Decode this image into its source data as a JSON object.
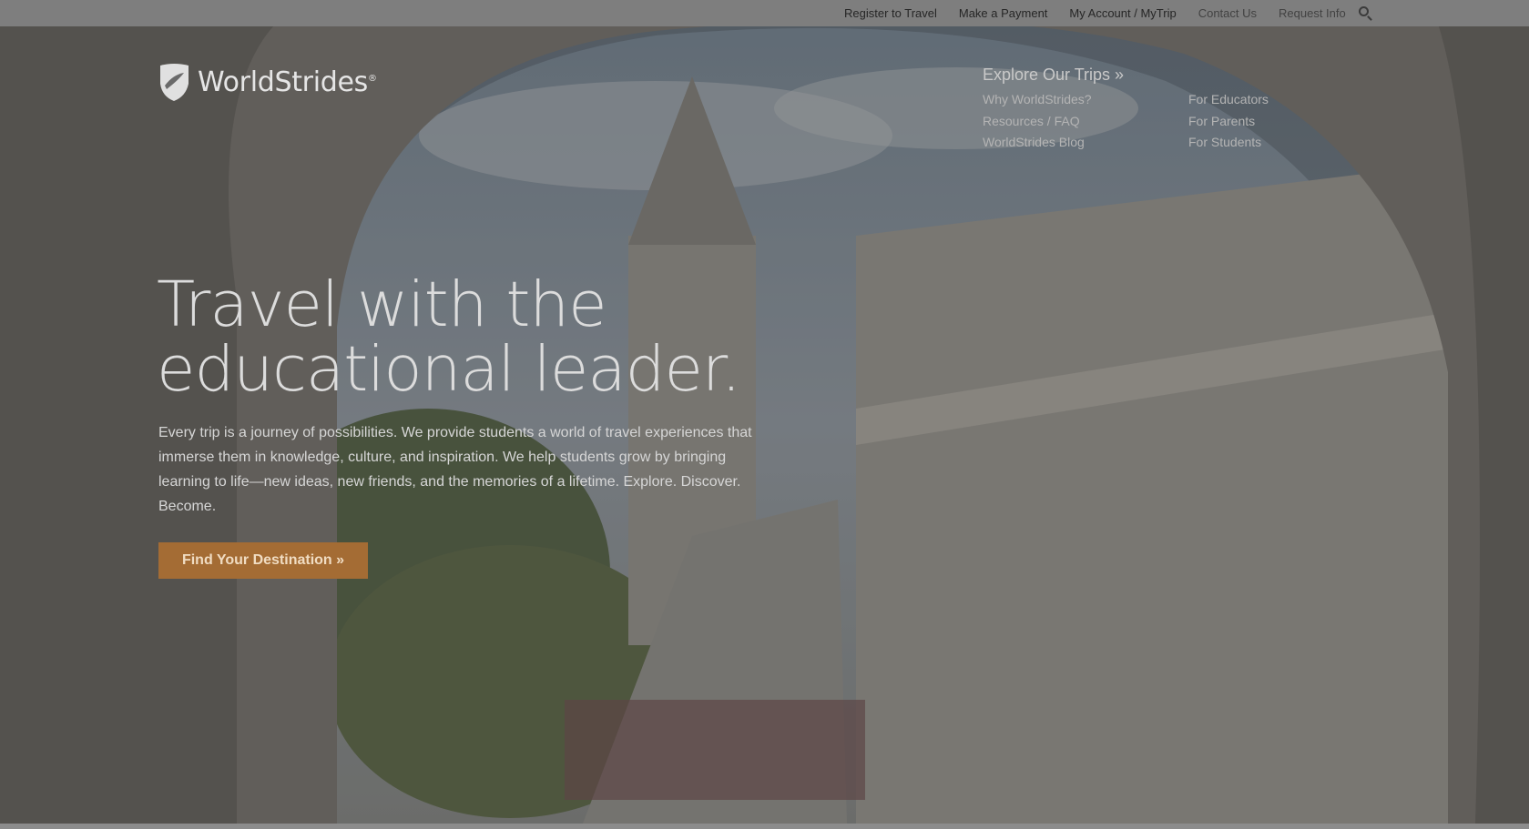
{
  "utility_nav": {
    "register": "Register to Travel",
    "payment": "Make a Payment",
    "account": "My Account / MyTrip",
    "contact": "Contact Us",
    "request": "Request Info",
    "search_icon": "search-icon"
  },
  "logo": {
    "name": "WorldStrides",
    "mark": "®"
  },
  "main_nav": {
    "explore": "Explore Our Trips »",
    "col1": [
      "Why WorldStrides?",
      "Resources / FAQ",
      "WorldStrides Blog"
    ],
    "col2": [
      "For Educators",
      "For Parents",
      "For Students"
    ]
  },
  "hero": {
    "headline_line1": "Travel with the",
    "headline_line2": "educational leader.",
    "body": "Every trip is a journey of possibilities. We provide students a world of travel experiences that immerse them in knowledge, culture, and inspiration. We help students grow by bringing learning to life—new ideas, new friends, and the memories of a lifetime. Explore. Discover. Become.",
    "cta": "Find Your Destination »"
  },
  "colors": {
    "cta": "#a46c34",
    "topbar": "#7e7e7e"
  }
}
